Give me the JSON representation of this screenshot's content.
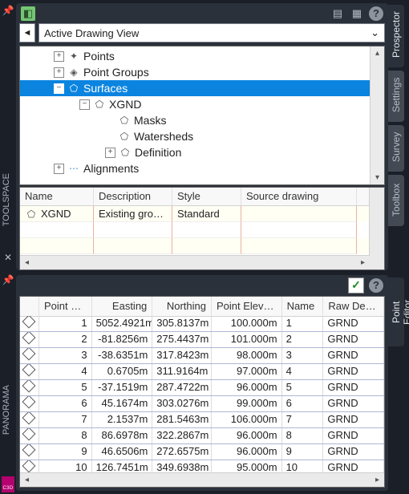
{
  "left_vertical": {
    "toolspace": "TOOLSPACE",
    "panorama": "PANORAMA",
    "badge": "C3D"
  },
  "right_tabs": {
    "prospector": "Prospector",
    "settings": "Settings",
    "survey": "Survey",
    "toolbox": "Toolbox",
    "point_editor": "Point Editor"
  },
  "top": {
    "dropdown_label": "Active Drawing View",
    "tree": {
      "points": "Points",
      "point_groups": "Point Groups",
      "surfaces": "Surfaces",
      "xgnd": "XGND",
      "masks": "Masks",
      "watersheds": "Watersheds",
      "definition": "Definition",
      "alignments": "Alignments"
    },
    "grid_headers": {
      "name": "Name",
      "description": "Description",
      "style": "Style",
      "source_drawing": "Source drawing"
    },
    "grid_rows": [
      {
        "name": "XGND",
        "description": "Existing ground s",
        "style": "Standard",
        "source_drawing": ""
      }
    ]
  },
  "bottom": {
    "headers": {
      "point_number": "Point Nu...",
      "easting": "Easting",
      "northing": "Northing",
      "point_elevation": "Point Elevati...",
      "name": "Name",
      "raw_description": "Raw Descripti..."
    },
    "rows": [
      {
        "pn": "1",
        "e": "5052.4921m",
        "n": "305.8137m",
        "pe": "100.000m",
        "name": "1",
        "rd": "GRND"
      },
      {
        "pn": "2",
        "e": "-81.8256m",
        "n": "275.4437m",
        "pe": "101.000m",
        "name": "2",
        "rd": "GRND"
      },
      {
        "pn": "3",
        "e": "-38.6351m",
        "n": "317.8423m",
        "pe": "98.000m",
        "name": "3",
        "rd": "GRND"
      },
      {
        "pn": "4",
        "e": "0.6705m",
        "n": "311.9164m",
        "pe": "97.000m",
        "name": "4",
        "rd": "GRND"
      },
      {
        "pn": "5",
        "e": "-37.1519m",
        "n": "287.4722m",
        "pe": "96.000m",
        "name": "5",
        "rd": "GRND"
      },
      {
        "pn": "6",
        "e": "45.1674m",
        "n": "303.0276m",
        "pe": "99.000m",
        "name": "6",
        "rd": "GRND"
      },
      {
        "pn": "7",
        "e": "2.1537m",
        "n": "281.5463m",
        "pe": "106.000m",
        "name": "7",
        "rd": "GRND"
      },
      {
        "pn": "8",
        "e": "86.6978m",
        "n": "322.2867m",
        "pe": "96.000m",
        "name": "8",
        "rd": "GRND"
      },
      {
        "pn": "9",
        "e": "46.6506m",
        "n": "272.6575m",
        "pe": "96.000m",
        "name": "9",
        "rd": "GRND"
      },
      {
        "pn": "10",
        "e": "126.7451m",
        "n": "349.6938m",
        "pe": "95.000m",
        "name": "10",
        "rd": "GRND"
      }
    ]
  }
}
